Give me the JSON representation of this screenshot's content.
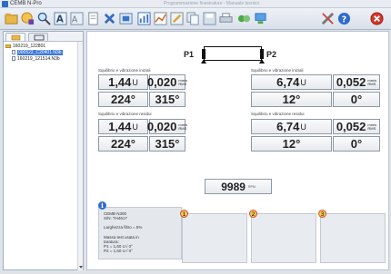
{
  "window": {
    "title": "CEMB N-Pro",
    "blurred_title": "Programmazione finestrature - Manuale tecnico"
  },
  "toolbar": {
    "buttons": [
      "open-folder",
      "wizard",
      "zoom",
      "text",
      "image",
      "delete",
      "chart",
      "graph",
      "edit",
      "copy",
      "save",
      "print",
      "tools",
      "switch",
      "settings",
      "help",
      "close"
    ]
  },
  "sidebar": {
    "items": [
      {
        "label": "160219_122801",
        "kind": "folder"
      },
      {
        "label": "000522_C20401.N3b",
        "kind": "file",
        "selected": true
      },
      {
        "label": "160219_121514.N3b",
        "kind": "file",
        "selected": false
      }
    ]
  },
  "rotor": {
    "p1": "P1",
    "p2": "P2"
  },
  "left_initial": {
    "label": "Squilibrio e vibrazione iniziali",
    "amp": "1,44",
    "amp_unit": "U",
    "vib": "0,020",
    "vib_unit_top": "mm/s",
    "vib_unit_bottom": "RMS",
    "phase": "224°",
    "vib_phase": "315°"
  },
  "right_initial": {
    "label": "Squilibrio e vibrazione iniziali",
    "amp": "6,74",
    "amp_unit": "U",
    "vib": "0,052",
    "vib_unit_top": "mm/s",
    "vib_unit_bottom": "RMS",
    "phase": "12°",
    "vib_phase": "0°"
  },
  "left_residual": {
    "label": "Squilibrio e vibrazione residui",
    "amp": "1,44",
    "amp_unit": "U",
    "vib": "0,020",
    "vib_unit_top": "mm/s",
    "vib_unit_bottom": "RMS",
    "phase": "224°",
    "vib_phase": "315°"
  },
  "right_residual": {
    "label": "Squilibrio e vibrazione residui",
    "amp": "6,74",
    "amp_unit": "U",
    "vib": "0,052",
    "vib_unit_top": "mm/s",
    "vib_unit_bottom": "RMS",
    "phase": "12°",
    "vib_phase": "0°"
  },
  "rpm": {
    "value": "9989",
    "unit": "RPM"
  },
  "info": {
    "line1": "CEMB N300",
    "line2": "S/N: TH4617",
    "line3": "Larghezza filtro = 5%",
    "line4": "Massa test usata in",
    "line5": "taratura:",
    "line6": "P1 = 1,60 U / 0°",
    "line7": "P2 = 1,60 U / 0°"
  },
  "planes": [
    {
      "num": "1"
    },
    {
      "num": "2"
    },
    {
      "num": "3"
    }
  ],
  "colors": {
    "accent": "#2c6fc0",
    "close": "#d8342a",
    "folder": "#e8b84a"
  }
}
